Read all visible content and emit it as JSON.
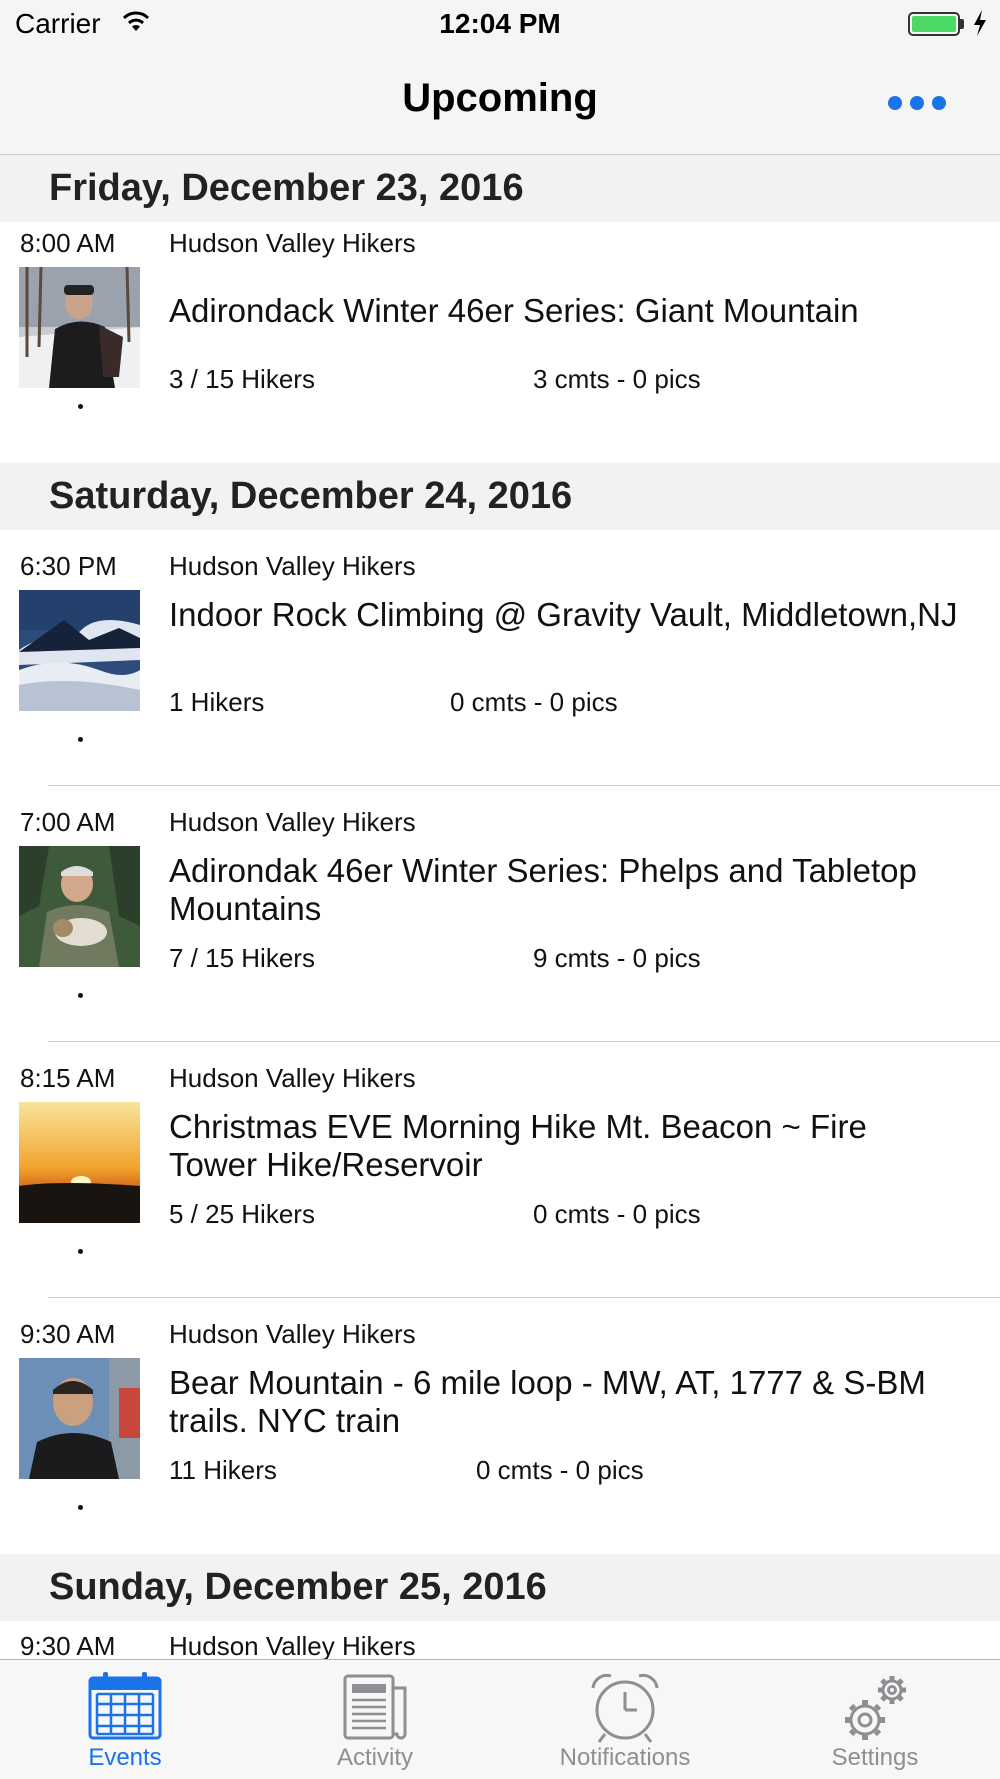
{
  "status_bar": {
    "carrier": "Carrier",
    "time": "12:04 PM",
    "battery_level": 1.0,
    "battery_color": "#4cd964"
  },
  "nav": {
    "title": "Upcoming",
    "more_icon": "more-dots-icon",
    "accent": "#1a73e8"
  },
  "sections": [
    {
      "date": "Friday, December 23, 2016",
      "events": [
        {
          "time": "8:00 AM",
          "group": "Hudson Valley Hikers",
          "title": "Adirondack Winter 46er Series: Giant Mountain",
          "hikers": "3 / 15 Hikers",
          "stats": "3 cmts - 0 pics",
          "thumb": "hiker-snow-photo"
        }
      ]
    },
    {
      "date": "Saturday, December 24, 2016",
      "events": [
        {
          "time": "6:30 PM",
          "group": "Hudson Valley Hikers",
          "title": "Indoor Rock Climbing @ Gravity Vault, Middletown,NJ",
          "hikers": "1 Hikers",
          "stats": "0 cmts - 0 pics",
          "thumb": "clouds-mountain-photo"
        },
        {
          "time": "7:00 AM",
          "group": "Hudson Valley Hikers",
          "title": "Adirondak 46er Winter Series: Phelps and Tabletop Mountains",
          "hikers": "7 / 15 Hikers",
          "stats": "9 cmts - 0 pics",
          "thumb": "hiker-dog-photo"
        },
        {
          "time": "8:15 AM",
          "group": "Hudson Valley Hikers",
          "title": "Christmas EVE Morning Hike Mt. Beacon ~ Fire Tower Hike/Reservoir",
          "hikers": "5 / 25 Hikers",
          "stats": "0 cmts - 0 pics",
          "thumb": "sunrise-photo"
        },
        {
          "time": "9:30 AM",
          "group": "Hudson Valley Hikers",
          "title": "Bear Mountain  - 6 mile loop  -  MW, AT, 1777 & S-BM trails.  NYC train",
          "hikers": "11 Hikers",
          "stats": "0 cmts - 0 pics",
          "thumb": "man-portrait-photo"
        }
      ]
    },
    {
      "date": "Sunday, December 25, 2016",
      "events": [
        {
          "time": "9:30 AM",
          "group": "Hudson Valley Hikers"
        }
      ]
    }
  ],
  "tabs": [
    {
      "label": "Events",
      "icon": "calendar-icon",
      "active": true
    },
    {
      "label": "Activity",
      "icon": "newspaper-icon",
      "active": false
    },
    {
      "label": "Notifications",
      "icon": "alarm-clock-icon",
      "active": false
    },
    {
      "label": "Settings",
      "icon": "gears-icon",
      "active": false
    }
  ]
}
